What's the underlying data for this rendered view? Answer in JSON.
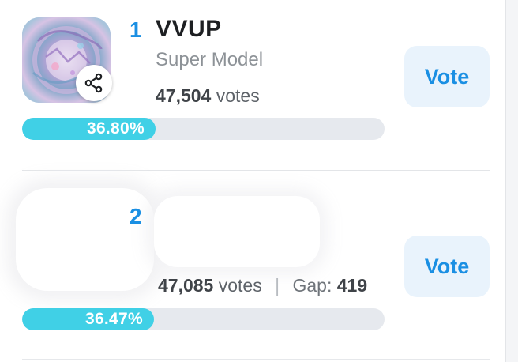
{
  "entries": [
    {
      "rank": "1",
      "name": "VVUP",
      "subtitle": "Super Model",
      "votes_number": "47,504",
      "votes_word": "votes",
      "vote_button": "Vote",
      "percent_label": "36.80%",
      "percent_value": 36.8,
      "share_icon": "share-icon"
    },
    {
      "rank": "2",
      "votes_number": "47,085",
      "votes_word": "votes",
      "separator": "|",
      "gap_label": "Gap:",
      "gap_value": "419",
      "vote_button": "Vote",
      "percent_label": "36.47%",
      "percent_value": 36.47
    }
  ],
  "colors": {
    "accent_blue": "#1a8fe3",
    "bar_fill": "#40d0e6",
    "bar_track": "#e6e9ee",
    "vote_button_bg": "#e9f3fc"
  }
}
